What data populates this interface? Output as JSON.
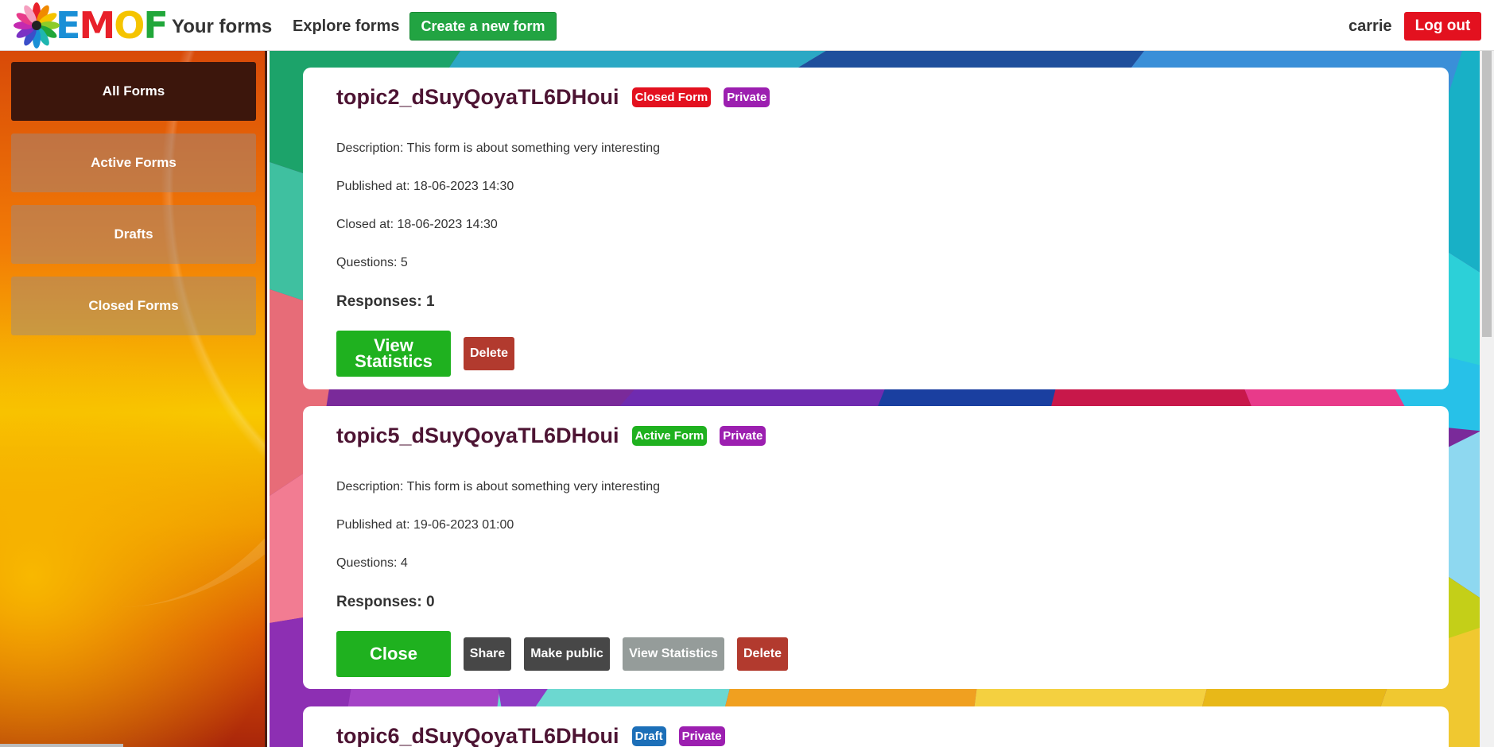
{
  "header": {
    "logo_text": [
      "E",
      "M",
      "O",
      "F"
    ],
    "nav_yours": "Your forms",
    "nav_explore": "Explore forms",
    "create_label": "Create a new form",
    "username": "carrie",
    "logout_label": "Log out"
  },
  "sidebar": {
    "items": [
      {
        "label": "All Forms"
      },
      {
        "label": "Active Forms"
      },
      {
        "label": "Drafts"
      },
      {
        "label": "Closed Forms"
      }
    ]
  },
  "forms": [
    {
      "title": "topic2_dSuyQoyaTL6DHoui",
      "status_badge": "Closed Form",
      "visibility_badge": "Private",
      "description": "Description: This form is about something very interesting",
      "published": "Published at: 18-06-2023 14:30",
      "closed": "Closed at: 18-06-2023 14:30",
      "questions": "Questions: 5",
      "responses": "Responses: 1",
      "actions": {
        "view_statistics": "View Statistics",
        "delete": "Delete"
      }
    },
    {
      "title": "topic5_dSuyQoyaTL6DHoui",
      "status_badge": "Active Form",
      "visibility_badge": "Private",
      "description": "Description: This form is about something very interesting",
      "published": "Published at: 19-06-2023 01:00",
      "questions": "Questions: 4",
      "responses": "Responses: 0",
      "actions": {
        "close": "Close",
        "share": "Share",
        "make_public": "Make public",
        "view_statistics": "View Statistics",
        "delete": "Delete"
      }
    },
    {
      "title": "topic6_dSuyQoyaTL6DHoui",
      "status_badge": "Draft",
      "visibility_badge": "Private"
    }
  ],
  "colors": {
    "accent_green": "#1fb11f",
    "danger_red": "#e3111f",
    "private_purple": "#9c1fb0",
    "draft_blue": "#1c6fb8",
    "title_maroon": "#4d1433"
  }
}
